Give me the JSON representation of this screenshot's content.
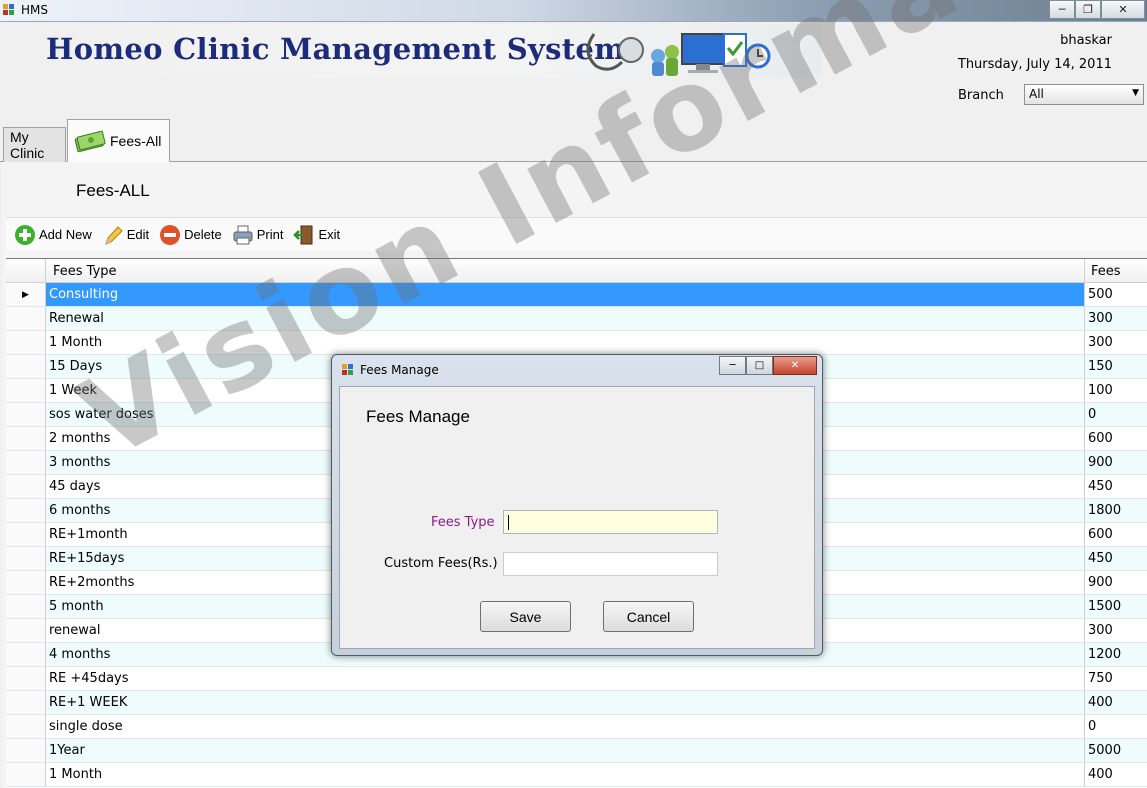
{
  "window": {
    "title": "HMS",
    "controls": [
      "minimize",
      "restore",
      "close"
    ]
  },
  "header": {
    "app_title": "Homeo Clinic Management System",
    "user": "bhaskar",
    "date": "Thursday, July 14, 2011",
    "branch_label": "Branch",
    "branch_value": "All"
  },
  "tabs": [
    {
      "label": "My Clinic",
      "active": false
    },
    {
      "label": "Fees-All",
      "active": true
    }
  ],
  "page": {
    "title": "Fees-ALL"
  },
  "toolbar": {
    "add": "Add New",
    "edit": "Edit",
    "delete": "Delete",
    "print": "Print",
    "exit": "Exit"
  },
  "grid": {
    "columns": [
      "Fees Type",
      "Fees"
    ],
    "rows": [
      {
        "type": "Consulting",
        "fees": "500"
      },
      {
        "type": "Renewal",
        "fees": "300"
      },
      {
        "type": "1 Month",
        "fees": "300"
      },
      {
        "type": "15 Days",
        "fees": "150"
      },
      {
        "type": "1 Week",
        "fees": "100"
      },
      {
        "type": "sos water doses",
        "fees": "0"
      },
      {
        "type": "2 months",
        "fees": "600"
      },
      {
        "type": "3 months",
        "fees": "900"
      },
      {
        "type": "45 days",
        "fees": "450"
      },
      {
        "type": "6 months",
        "fees": "1800"
      },
      {
        "type": "RE+1month",
        "fees": "600"
      },
      {
        "type": "RE+15days",
        "fees": "450"
      },
      {
        "type": "RE+2months",
        "fees": "900"
      },
      {
        "type": "5 month",
        "fees": "1500"
      },
      {
        "type": "renewal",
        "fees": "300"
      },
      {
        "type": "4 months",
        "fees": "1200"
      },
      {
        "type": "RE +45days",
        "fees": "750"
      },
      {
        "type": "RE+1 WEEK",
        "fees": "400"
      },
      {
        "type": "single dose",
        "fees": "0"
      },
      {
        "type": "1Year",
        "fees": "5000"
      },
      {
        "type": "1 Month",
        "fees": "400"
      }
    ],
    "selected_index": 0
  },
  "dialog": {
    "title": "Fees Manage",
    "heading": "Fees Manage",
    "fees_type_label": "Fees Type",
    "fees_type_value": "",
    "custom_fees_label": "Custom Fees(Rs.)",
    "custom_fees_value": "",
    "save": "Save",
    "cancel": "Cancel"
  },
  "watermark": "Vision Informatics",
  "colors": {
    "selection": "#3399ff",
    "alt_row": "#eefcfc",
    "heading": "#1c2b7a",
    "label_accent": "#8b1a8b"
  }
}
